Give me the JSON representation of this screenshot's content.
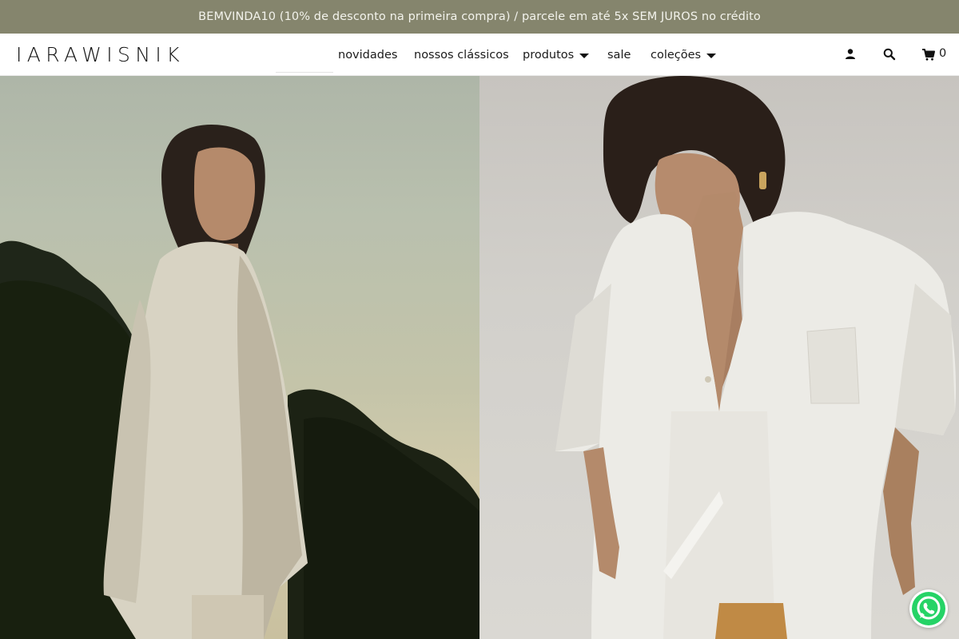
{
  "promo": {
    "text": "BEMVINDA10 (10% de desconto na primeira compra) / parcele em até 5x SEM JUROS no crédito"
  },
  "header": {
    "logo": "IARAWISNIK",
    "nav": [
      {
        "label": "novidades",
        "has_dropdown": false
      },
      {
        "label": "nossos clássicos",
        "has_dropdown": false
      },
      {
        "label": "produtos",
        "has_dropdown": true
      },
      {
        "label": "sale",
        "has_dropdown": false
      },
      {
        "label": "coleções",
        "has_dropdown": true
      }
    ],
    "icons": [
      "user-icon",
      "search-icon",
      "cart-icon"
    ],
    "cart_count": "0"
  },
  "hero": {
    "images": [
      "woman-in-linen-blazer-at-dusk",
      "woman-in-white-linen-shirt"
    ]
  },
  "floating": {
    "icon": "whatsapp-icon",
    "color": "#25d366"
  },
  "colors": {
    "promo_bg": "#85856d",
    "promo_text": "#f3f3ec",
    "nav_text": "#1b1b1b"
  }
}
